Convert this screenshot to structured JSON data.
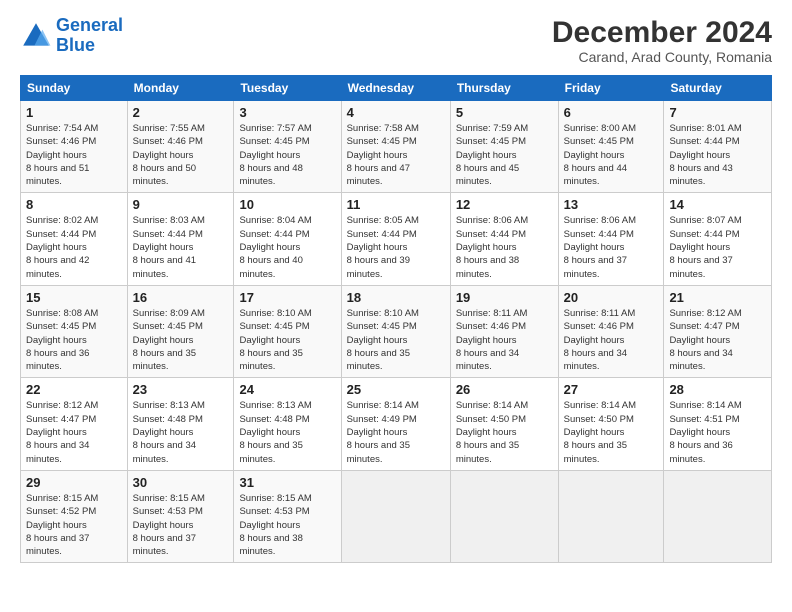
{
  "logo": {
    "line1": "General",
    "line2": "Blue"
  },
  "title": "December 2024",
  "subtitle": "Carand, Arad County, Romania",
  "days_of_week": [
    "Sunday",
    "Monday",
    "Tuesday",
    "Wednesday",
    "Thursday",
    "Friday",
    "Saturday"
  ],
  "weeks": [
    [
      {
        "day": "1",
        "sunrise": "7:54 AM",
        "sunset": "4:46 PM",
        "daylight": "8 hours and 51 minutes."
      },
      {
        "day": "2",
        "sunrise": "7:55 AM",
        "sunset": "4:46 PM",
        "daylight": "8 hours and 50 minutes."
      },
      {
        "day": "3",
        "sunrise": "7:57 AM",
        "sunset": "4:45 PM",
        "daylight": "8 hours and 48 minutes."
      },
      {
        "day": "4",
        "sunrise": "7:58 AM",
        "sunset": "4:45 PM",
        "daylight": "8 hours and 47 minutes."
      },
      {
        "day": "5",
        "sunrise": "7:59 AM",
        "sunset": "4:45 PM",
        "daylight": "8 hours and 45 minutes."
      },
      {
        "day": "6",
        "sunrise": "8:00 AM",
        "sunset": "4:45 PM",
        "daylight": "8 hours and 44 minutes."
      },
      {
        "day": "7",
        "sunrise": "8:01 AM",
        "sunset": "4:44 PM",
        "daylight": "8 hours and 43 minutes."
      }
    ],
    [
      {
        "day": "8",
        "sunrise": "8:02 AM",
        "sunset": "4:44 PM",
        "daylight": "8 hours and 42 minutes."
      },
      {
        "day": "9",
        "sunrise": "8:03 AM",
        "sunset": "4:44 PM",
        "daylight": "8 hours and 41 minutes."
      },
      {
        "day": "10",
        "sunrise": "8:04 AM",
        "sunset": "4:44 PM",
        "daylight": "8 hours and 40 minutes."
      },
      {
        "day": "11",
        "sunrise": "8:05 AM",
        "sunset": "4:44 PM",
        "daylight": "8 hours and 39 minutes."
      },
      {
        "day": "12",
        "sunrise": "8:06 AM",
        "sunset": "4:44 PM",
        "daylight": "8 hours and 38 minutes."
      },
      {
        "day": "13",
        "sunrise": "8:06 AM",
        "sunset": "4:44 PM",
        "daylight": "8 hours and 37 minutes."
      },
      {
        "day": "14",
        "sunrise": "8:07 AM",
        "sunset": "4:44 PM",
        "daylight": "8 hours and 37 minutes."
      }
    ],
    [
      {
        "day": "15",
        "sunrise": "8:08 AM",
        "sunset": "4:45 PM",
        "daylight": "8 hours and 36 minutes."
      },
      {
        "day": "16",
        "sunrise": "8:09 AM",
        "sunset": "4:45 PM",
        "daylight": "8 hours and 35 minutes."
      },
      {
        "day": "17",
        "sunrise": "8:10 AM",
        "sunset": "4:45 PM",
        "daylight": "8 hours and 35 minutes."
      },
      {
        "day": "18",
        "sunrise": "8:10 AM",
        "sunset": "4:45 PM",
        "daylight": "8 hours and 35 minutes."
      },
      {
        "day": "19",
        "sunrise": "8:11 AM",
        "sunset": "4:46 PM",
        "daylight": "8 hours and 34 minutes."
      },
      {
        "day": "20",
        "sunrise": "8:11 AM",
        "sunset": "4:46 PM",
        "daylight": "8 hours and 34 minutes."
      },
      {
        "day": "21",
        "sunrise": "8:12 AM",
        "sunset": "4:47 PM",
        "daylight": "8 hours and 34 minutes."
      }
    ],
    [
      {
        "day": "22",
        "sunrise": "8:12 AM",
        "sunset": "4:47 PM",
        "daylight": "8 hours and 34 minutes."
      },
      {
        "day": "23",
        "sunrise": "8:13 AM",
        "sunset": "4:48 PM",
        "daylight": "8 hours and 34 minutes."
      },
      {
        "day": "24",
        "sunrise": "8:13 AM",
        "sunset": "4:48 PM",
        "daylight": "8 hours and 35 minutes."
      },
      {
        "day": "25",
        "sunrise": "8:14 AM",
        "sunset": "4:49 PM",
        "daylight": "8 hours and 35 minutes."
      },
      {
        "day": "26",
        "sunrise": "8:14 AM",
        "sunset": "4:50 PM",
        "daylight": "8 hours and 35 minutes."
      },
      {
        "day": "27",
        "sunrise": "8:14 AM",
        "sunset": "4:50 PM",
        "daylight": "8 hours and 35 minutes."
      },
      {
        "day": "28",
        "sunrise": "8:14 AM",
        "sunset": "4:51 PM",
        "daylight": "8 hours and 36 minutes."
      }
    ],
    [
      {
        "day": "29",
        "sunrise": "8:15 AM",
        "sunset": "4:52 PM",
        "daylight": "8 hours and 37 minutes."
      },
      {
        "day": "30",
        "sunrise": "8:15 AM",
        "sunset": "4:53 PM",
        "daylight": "8 hours and 37 minutes."
      },
      {
        "day": "31",
        "sunrise": "8:15 AM",
        "sunset": "4:53 PM",
        "daylight": "8 hours and 38 minutes."
      },
      null,
      null,
      null,
      null
    ]
  ]
}
